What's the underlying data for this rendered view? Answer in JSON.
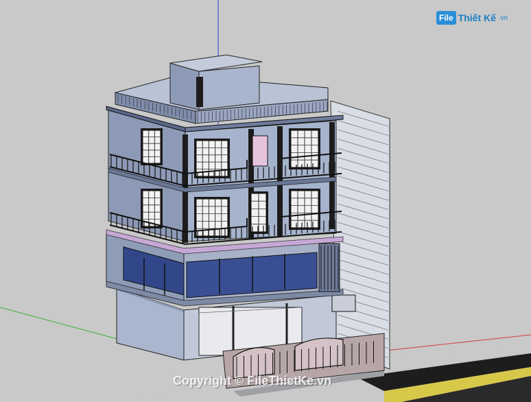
{
  "watermark": {
    "logo_box": "File",
    "logo_text": "Thiết Kế",
    "logo_tld": ".vn",
    "copyright": "Copyright © FileThietKe.vn"
  },
  "colors": {
    "background": "#c9c9c9",
    "building_face": "#a5b3cc",
    "building_side": "#b9c3d6",
    "glass": "#32478a",
    "rail": "#1a1a1a",
    "sidewalk": "#9fa0a4",
    "curb": "#d8c84a",
    "axis_red": "#d63a3a",
    "axis_green": "#35b035",
    "axis_blue": "#2f3fd8"
  }
}
